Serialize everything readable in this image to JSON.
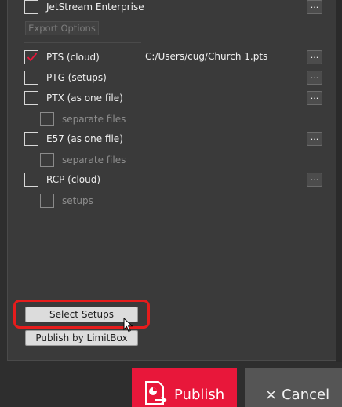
{
  "options": [
    {
      "label": "JetStream Enterprise",
      "checked": false
    },
    {
      "label": "PTS (cloud)",
      "checked": true
    },
    {
      "label": "PTG (setups)",
      "checked": false
    },
    {
      "label": "PTX (as one file)",
      "checked": false
    },
    {
      "label": "E57 (as one file)",
      "checked": false
    },
    {
      "label": "RCP (cloud)",
      "checked": false
    }
  ],
  "sub_options": [
    {
      "label": "separate files",
      "disabled": true
    },
    {
      "label": "separate files",
      "disabled": true
    },
    {
      "label": "setups",
      "disabled": true
    }
  ],
  "export_options_label": "Export Options",
  "pts_path": "C:/Users/cug/Church 1.pts",
  "browse_label": "...",
  "select_setups_label": "Select Setups",
  "publish_limitbox_label": "Publish by LimitBox",
  "publish_label": "Publish",
  "cancel_label": "Cancel",
  "cancel_icon": "×",
  "colors": {
    "accent": "#e8173a",
    "highlight": "#e61c1c",
    "check": "#e8173a"
  }
}
